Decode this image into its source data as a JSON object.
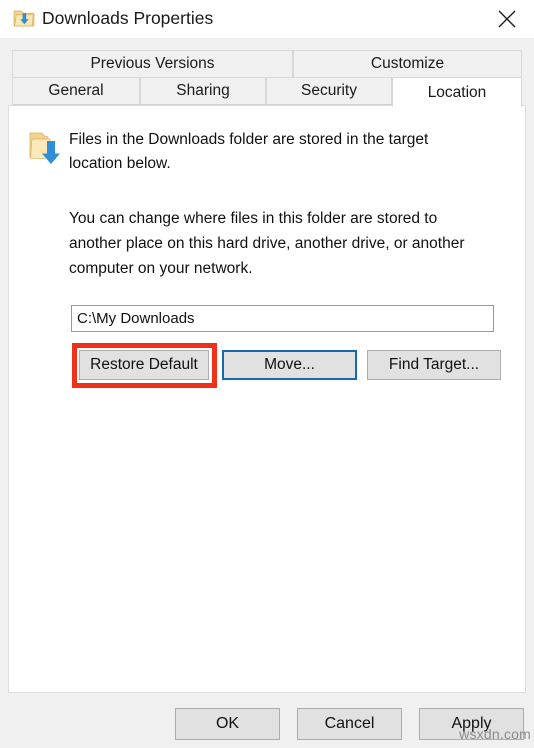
{
  "window": {
    "title": "Downloads Properties",
    "icon": "downloads-folder-icon",
    "close_label": "✕"
  },
  "tabs": {
    "row_top": [
      {
        "label": "Previous Versions",
        "selected": false
      },
      {
        "label": "Customize",
        "selected": false
      }
    ],
    "row_bottom": [
      {
        "label": "General",
        "selected": false
      },
      {
        "label": "Sharing",
        "selected": false
      },
      {
        "label": "Security",
        "selected": false
      },
      {
        "label": "Location",
        "selected": true
      }
    ]
  },
  "location_panel": {
    "icon": "downloads-folder-icon",
    "intro_text": "Files in the Downloads folder are stored in the target location below.",
    "description_text": "You can change where files in this folder are stored to another place on this hard drive, another drive, or another computer on your network.",
    "path_value": "C:\\My Downloads",
    "path_placeholder": "",
    "buttons": {
      "restore_default": "Restore Default",
      "move": "Move...",
      "find_target": "Find Target..."
    }
  },
  "footer": {
    "ok": "OK",
    "cancel": "Cancel",
    "apply": "Apply"
  },
  "watermark": "wsxdn.com",
  "colors": {
    "annotation_red": "#f03018",
    "focus_blue": "#1768b0",
    "dialog_background": "#f0f0f0",
    "panel_background": "#ffffff",
    "button_face": "#e1e1e1",
    "folder_yellow": "#f6d98a",
    "arrow_blue": "#2e8fd8"
  }
}
